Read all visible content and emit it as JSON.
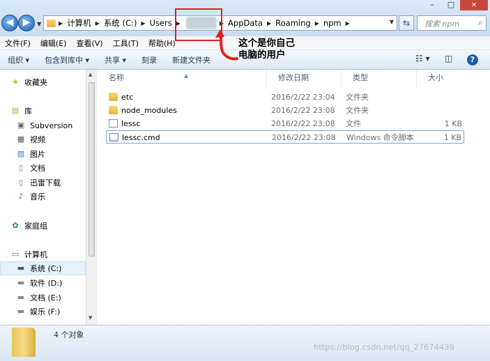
{
  "window_controls": {
    "minimize": "–",
    "maximize": "□",
    "close": "✕"
  },
  "address": {
    "crumbs": [
      "计算机",
      "系统 (C:)",
      "Users",
      "AppData",
      "Roaming",
      "npm"
    ],
    "search_placeholder": "搜索 npm"
  },
  "menu": [
    "文件(F)",
    "编辑(E)",
    "查看(V)",
    "工具(T)",
    "帮助(H)"
  ],
  "toolbar": {
    "organize": "组织 ▾",
    "include_library": "包含到库中 ▾",
    "share": "共享 ▾",
    "burn": "刻录",
    "new_folder": "新建文件夹"
  },
  "annotation": {
    "line1": "这个是你自己",
    "line2": "电脑的用户"
  },
  "nav": [
    {
      "label": "收藏夹",
      "icon": "star-icon"
    },
    {
      "label": "库",
      "icon": "library-icon"
    },
    {
      "label": "Subversion",
      "icon": "folder-icon"
    },
    {
      "label": "视频",
      "icon": "video-icon"
    },
    {
      "label": "图片",
      "icon": "image-icon"
    },
    {
      "label": "文档",
      "icon": "document-icon"
    },
    {
      "label": "迅雷下载",
      "icon": "download-icon"
    },
    {
      "label": "音乐",
      "icon": "music-icon"
    },
    {
      "label": "家庭组",
      "icon": "homegroup-icon"
    },
    {
      "label": "计算机",
      "icon": "computer-icon"
    },
    {
      "label": "系统 (C:)",
      "icon": "drive-icon"
    },
    {
      "label": "软件 (D:)",
      "icon": "drive-icon"
    },
    {
      "label": "文档 (E:)",
      "icon": "drive-icon"
    },
    {
      "label": "娱乐 (F:)",
      "icon": "drive-icon"
    }
  ],
  "columns": {
    "name": "名称",
    "date": "修改日期",
    "type": "类型",
    "size": "大小"
  },
  "files": [
    {
      "name": "etc",
      "date": "2016/2/22 23:04",
      "type": "文件夹",
      "size": "",
      "kind": "folder"
    },
    {
      "name": "node_modules",
      "date": "2016/2/22 23:08",
      "type": "文件夹",
      "size": "",
      "kind": "folder"
    },
    {
      "name": "lessc",
      "date": "2016/2/22 23:08",
      "type": "文件",
      "size": "1 KB",
      "kind": "file"
    },
    {
      "name": "lessc.cmd",
      "date": "2016/2/22 23:08",
      "type": "Windows 命令脚本",
      "size": "1 KB",
      "kind": "cmd"
    }
  ],
  "status": {
    "count": "4 个对象"
  },
  "watermark": "https://blog.csdn.net/qq_27674439",
  "colors": {
    "accent": "#1c5fb4",
    "highlight_border": "#e02020",
    "arrow": "#e02020"
  }
}
